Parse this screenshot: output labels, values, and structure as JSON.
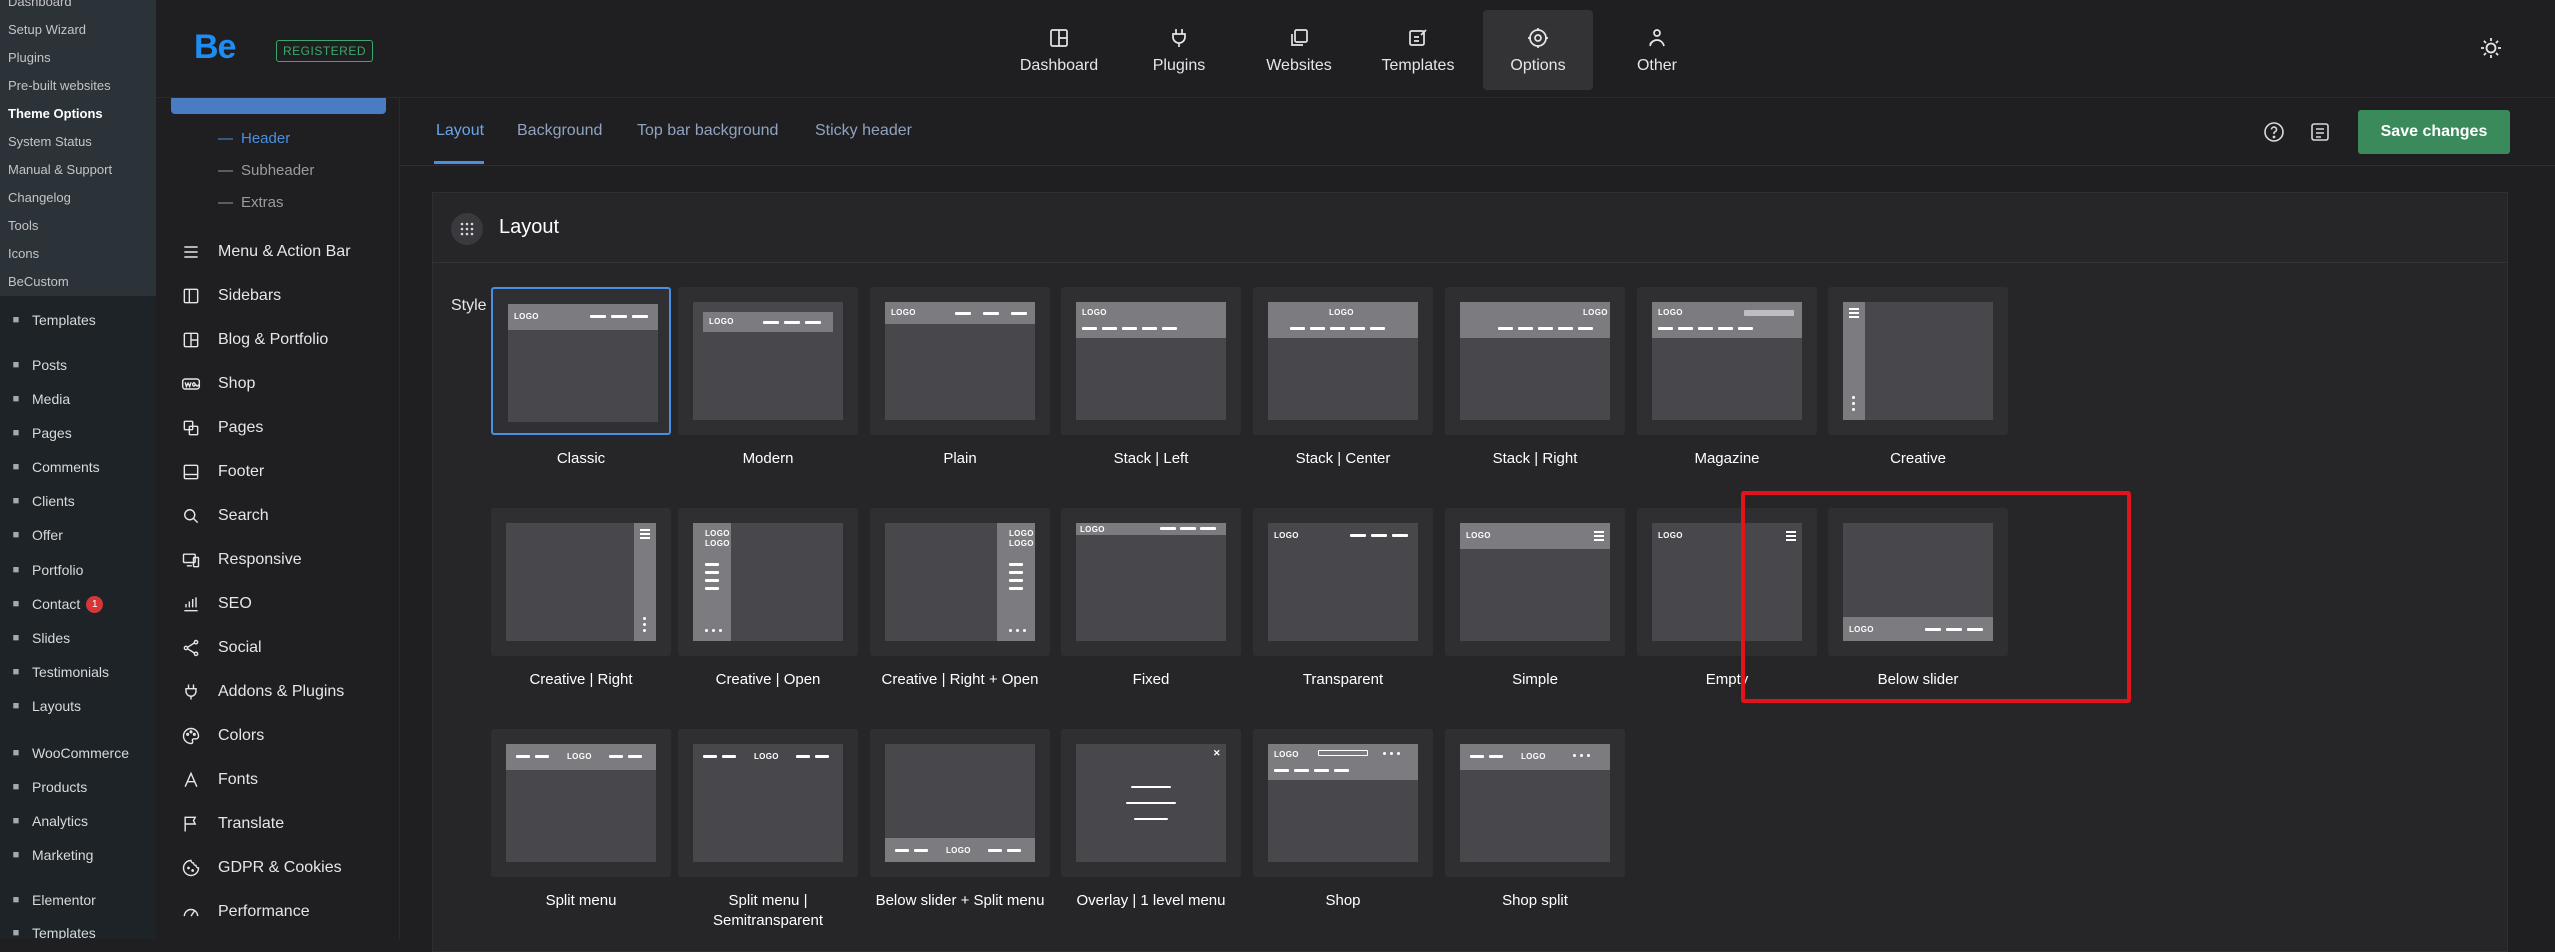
{
  "wp_sidebar": {
    "submenu": [
      {
        "label": "Dashboard",
        "active": false
      },
      {
        "label": "Setup Wizard",
        "active": false
      },
      {
        "label": "Plugins",
        "active": false
      },
      {
        "label": "Pre-built websites",
        "active": false
      },
      {
        "label": "Theme Options",
        "active": true
      },
      {
        "label": "System Status",
        "active": false
      },
      {
        "label": "Manual & Support",
        "active": false
      },
      {
        "label": "Changelog",
        "active": false
      },
      {
        "label": "Tools",
        "active": false
      },
      {
        "label": "Icons",
        "active": false
      },
      {
        "label": "BeCustom",
        "active": false
      }
    ],
    "menu": [
      {
        "label": "Templates",
        "icon": "templates-icon"
      },
      {
        "label": "Posts",
        "icon": "pin-icon"
      },
      {
        "label": "Media",
        "icon": "media-icon"
      },
      {
        "label": "Pages",
        "icon": "pages-icon"
      },
      {
        "label": "Comments",
        "icon": "comments-icon"
      },
      {
        "label": "Clients",
        "icon": "clients-icon"
      },
      {
        "label": "Offer",
        "icon": "offer-icon"
      },
      {
        "label": "Portfolio",
        "icon": "portfolio-icon"
      },
      {
        "label": "Contact",
        "icon": "contact-icon",
        "badge": "1"
      },
      {
        "label": "Slides",
        "icon": "slides-icon"
      },
      {
        "label": "Testimonials",
        "icon": "quote-icon"
      },
      {
        "label": "Layouts",
        "icon": "layouts-icon"
      },
      {
        "label": "WooCommerce",
        "icon": "woo-icon"
      },
      {
        "label": "Products",
        "icon": "products-icon"
      },
      {
        "label": "Analytics",
        "icon": "analytics-icon"
      },
      {
        "label": "Marketing",
        "icon": "marketing-icon"
      },
      {
        "label": "Elementor",
        "icon": "elementor-icon"
      },
      {
        "label": "Templates",
        "icon": "templates-icon"
      }
    ]
  },
  "topbar": {
    "logo": "Be",
    "registered": "REGISTERED",
    "nav": [
      {
        "label": "Dashboard",
        "icon": "dashboard-icon",
        "active": false
      },
      {
        "label": "Plugins",
        "icon": "plug-icon",
        "active": false
      },
      {
        "label": "Websites",
        "icon": "websites-icon",
        "active": false
      },
      {
        "label": "Templates",
        "icon": "templates-edit-icon",
        "active": false
      },
      {
        "label": "Options",
        "icon": "gear-icon",
        "active": true
      },
      {
        "label": "Other",
        "icon": "other-icon",
        "active": false
      }
    ]
  },
  "options_nav": {
    "sub_items": [
      {
        "label": "Header",
        "active": true
      },
      {
        "label": "Subheader",
        "active": false
      },
      {
        "label": "Extras",
        "active": false
      }
    ],
    "items": [
      {
        "label": "Menu & Action Bar",
        "icon": "menu-icon"
      },
      {
        "label": "Sidebars",
        "icon": "sidebar-icon"
      },
      {
        "label": "Blog & Portfolio",
        "icon": "grid-icon"
      },
      {
        "label": "Shop",
        "icon": "woo-icon"
      },
      {
        "label": "Pages",
        "icon": "pages-icon"
      },
      {
        "label": "Footer",
        "icon": "footer-icon"
      },
      {
        "label": "Search",
        "icon": "search-icon"
      },
      {
        "label": "Responsive",
        "icon": "responsive-icon"
      },
      {
        "label": "SEO",
        "icon": "seo-icon"
      },
      {
        "label": "Social",
        "icon": "share-icon"
      },
      {
        "label": "Addons & Plugins",
        "icon": "plug-icon"
      },
      {
        "label": "Colors",
        "icon": "palette-icon"
      },
      {
        "label": "Fonts",
        "icon": "font-icon"
      },
      {
        "label": "Translate",
        "icon": "flag-icon"
      },
      {
        "label": "GDPR & Cookies",
        "icon": "cookie-icon"
      },
      {
        "label": "Performance",
        "icon": "gauge-icon"
      }
    ]
  },
  "tabs": [
    {
      "label": "Layout",
      "active": true
    },
    {
      "label": "Background",
      "active": false
    },
    {
      "label": "Top bar background",
      "active": false
    },
    {
      "label": "Sticky header",
      "active": false
    }
  ],
  "save_label": "Save changes",
  "panel": {
    "title": "Layout",
    "style_label": "Style",
    "logo_text": "LOGO",
    "layouts": [
      {
        "label": "Classic",
        "selected": true
      },
      {
        "label": "Modern"
      },
      {
        "label": "Plain"
      },
      {
        "label": "Stack | Left"
      },
      {
        "label": "Stack | Center"
      },
      {
        "label": "Stack | Right"
      },
      {
        "label": "Magazine"
      },
      {
        "label": "Creative"
      },
      {
        "label": "Creative | Right"
      },
      {
        "label": "Creative | Open"
      },
      {
        "label": "Creative | Right + Open"
      },
      {
        "label": "Fixed"
      },
      {
        "label": "Transparent"
      },
      {
        "label": "Simple"
      },
      {
        "label": "Empty"
      },
      {
        "label": "Below slider"
      },
      {
        "label": "Split menu"
      },
      {
        "label": "Split menu |\nSemitransparent"
      },
      {
        "label": "Below slider + Split menu"
      },
      {
        "label": "Overlay | 1 level menu"
      },
      {
        "label": "Shop"
      },
      {
        "label": "Shop split"
      }
    ]
  },
  "colors": {
    "accent": "#4a90e2",
    "save": "#3a8a5c",
    "highlight": "#e0141a",
    "be_logo": "#1e8cf0"
  }
}
